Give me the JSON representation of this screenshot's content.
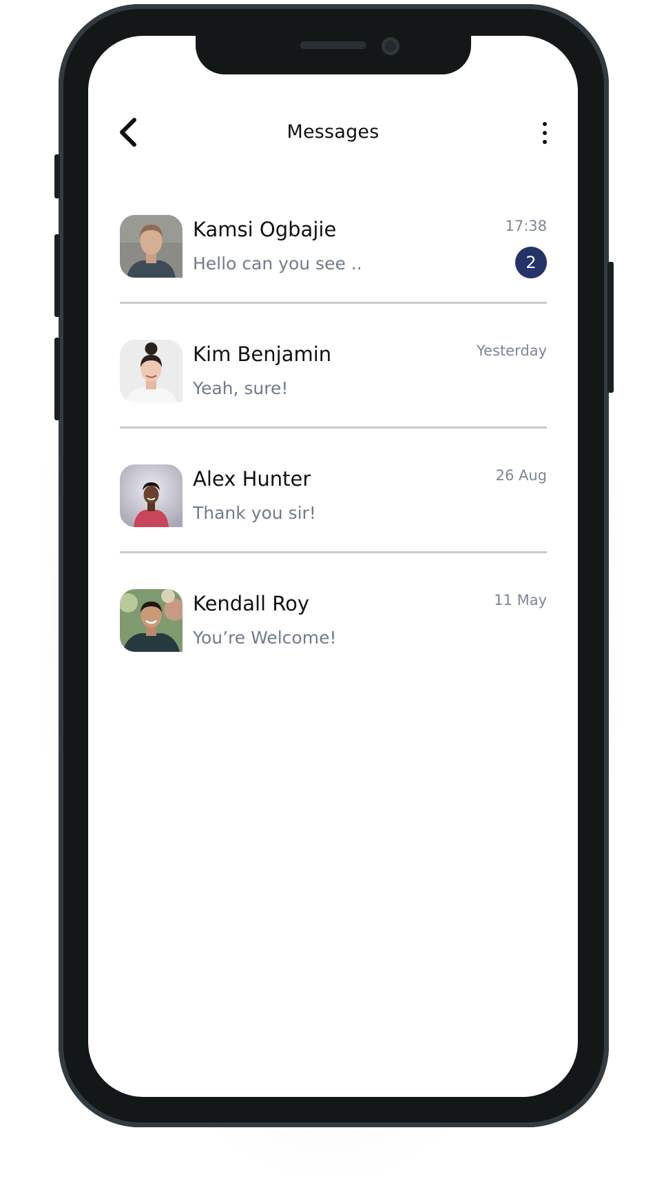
{
  "header": {
    "title": "Messages"
  },
  "colors": {
    "badge": "#253468",
    "preview_text": "#717b8a",
    "divider": "#c9cacc"
  },
  "conversations": [
    {
      "name": "Kamsi Ogbajie",
      "preview": "Hello can you see ..",
      "time": "17:38",
      "unread": "2"
    },
    {
      "name": "Kim Benjamin",
      "preview": "Yeah, sure!",
      "time": "Yesterday"
    },
    {
      "name": "Alex Hunter",
      "preview": "Thank you sir!",
      "time": "26 Aug"
    },
    {
      "name": "Kendall Roy",
      "preview": "You’re Welcome!",
      "time": "11 May"
    }
  ]
}
